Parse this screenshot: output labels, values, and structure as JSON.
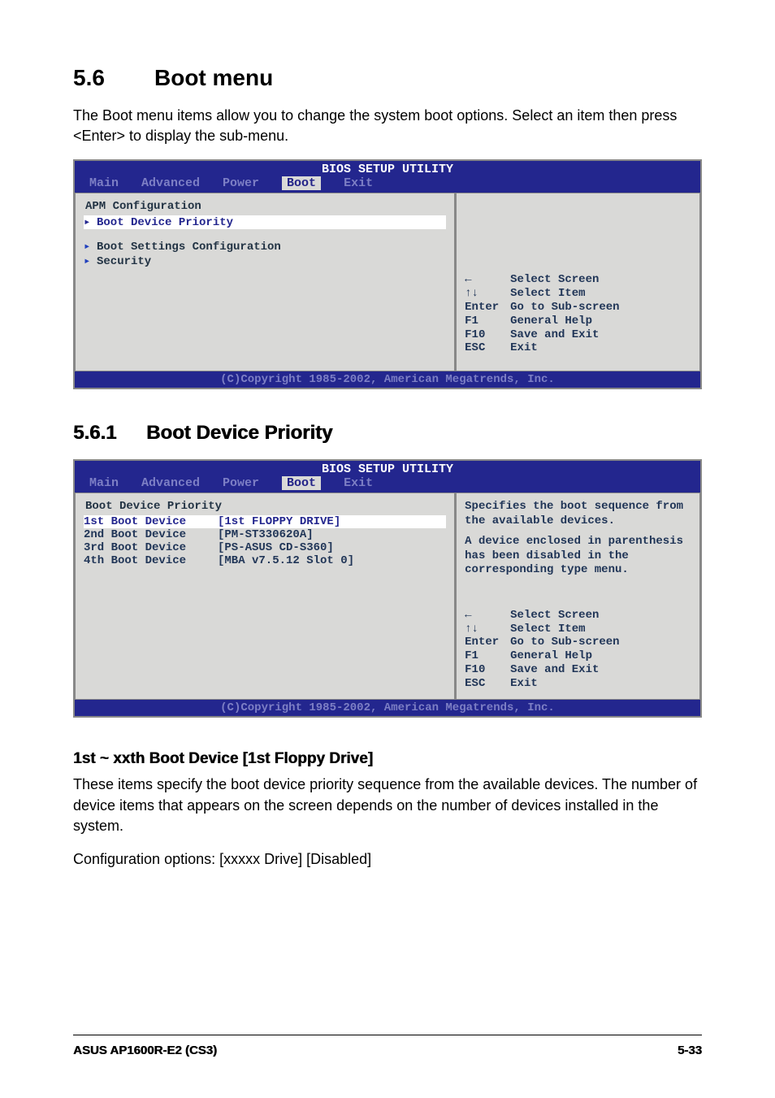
{
  "section": {
    "number": "5.6",
    "title": "Boot menu",
    "intro": "The Boot menu items allow you to change the system boot options. Select an item then press <Enter> to display the sub-menu."
  },
  "bios1": {
    "title": "BIOS SETUP UTILITY",
    "tabs": {
      "t0": "Main",
      "t1": "Advanced",
      "t2": "Power",
      "t3": "Boot",
      "t4": "Exit"
    },
    "items": {
      "apm": "APM Configuration",
      "bdp": "Boot Device Priority",
      "bsc": "Boot Settings Configuration",
      "sec": "Security"
    },
    "legend": {
      "l0k": "←",
      "l0v": "Select Screen",
      "l1k": "↑↓",
      "l1v": "Select Item",
      "l2k": "Enter",
      "l2v": "Go to Sub-screen",
      "l3k": "F1",
      "l3v": "General Help",
      "l4k": "F10",
      "l4v": "Save and Exit",
      "l5k": "ESC",
      "l5v": "Exit"
    },
    "footer": "(C)Copyright 1985-2002, American Megatrends, Inc."
  },
  "subsection": {
    "number": "5.6.1",
    "title": "Boot Device Priority"
  },
  "bios2": {
    "title": "BIOS SETUP UTILITY",
    "tabs": {
      "t0": "Main",
      "t1": "Advanced",
      "t2": "Power",
      "t3": "Boot",
      "t4": "Exit"
    },
    "heading": "Boot Device Priority",
    "rows": {
      "r0l": "1st Boot Device",
      "r0v": "[1st FLOPPY DRIVE]",
      "r1l": "2nd Boot Device",
      "r1v": "[PM-ST330620A]",
      "r2l": "3rd Boot Device",
      "r2v": "[PS-ASUS CD-S360]",
      "r3l": "4th Boot Device",
      "r3v": "[MBA v7.5.12 Slot 0]"
    },
    "help1": "Specifies the boot sequence from the available devices.",
    "help2": "A device enclosed in parenthesis has been disabled in the corresponding type menu.",
    "legend": {
      "l0k": "←",
      "l0v": "Select Screen",
      "l1k": "↑↓",
      "l1v": "Select Item",
      "l2k": "Enter",
      "l2v": "Go to Sub-screen",
      "l3k": "F1",
      "l3v": "General Help",
      "l4k": "F10",
      "l4v": "Save and Exit",
      "l5k": "ESC",
      "l5v": "Exit"
    },
    "footer": "(C)Copyright 1985-2002, American Megatrends, Inc."
  },
  "item": {
    "heading": "1st ~ xxth Boot Device [1st Floppy Drive]",
    "p1": "These items specify the boot device priority sequence from the available devices. The number of device items that appears on the screen depends on the number of devices installed in the system.",
    "p2": "Configuration options: [xxxxx Drive] [Disabled]"
  },
  "footer": {
    "left": "ASUS AP1600R-E2 (CS3)",
    "right": "5-33"
  }
}
